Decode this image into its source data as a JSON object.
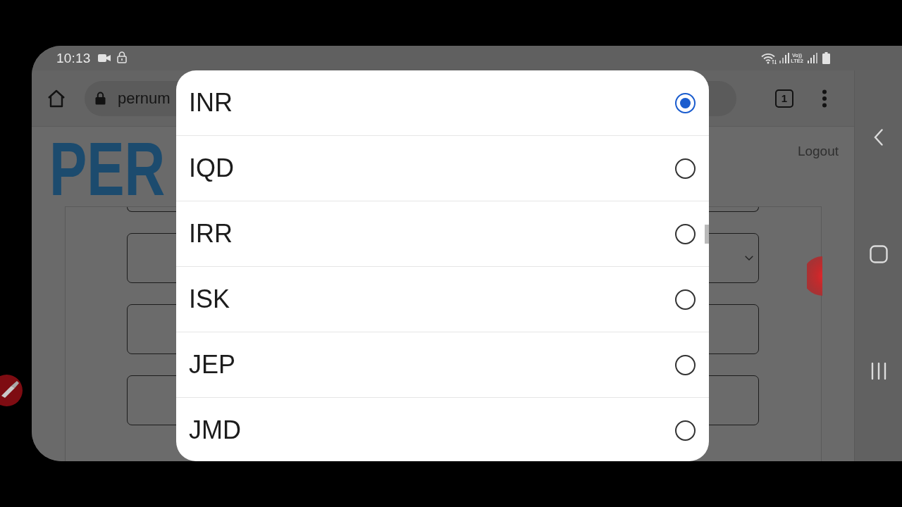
{
  "status_bar": {
    "time": "10:13",
    "volte": "Vo))",
    "network": "LTE2"
  },
  "browser": {
    "url": "pernum",
    "tab_count": "1"
  },
  "page": {
    "logo": "PER",
    "logout": "Logout",
    "fields": [
      {
        "kind": "input"
      },
      {
        "kind": "select"
      },
      {
        "kind": "input"
      },
      {
        "kind": "input"
      }
    ]
  },
  "dialog": {
    "options": [
      {
        "label": "INR",
        "selected": true
      },
      {
        "label": "IQD",
        "selected": false
      },
      {
        "label": "IRR",
        "selected": false
      },
      {
        "label": "ISK",
        "selected": false
      },
      {
        "label": "JEP",
        "selected": false
      },
      {
        "label": "JMD",
        "selected": false
      }
    ]
  }
}
